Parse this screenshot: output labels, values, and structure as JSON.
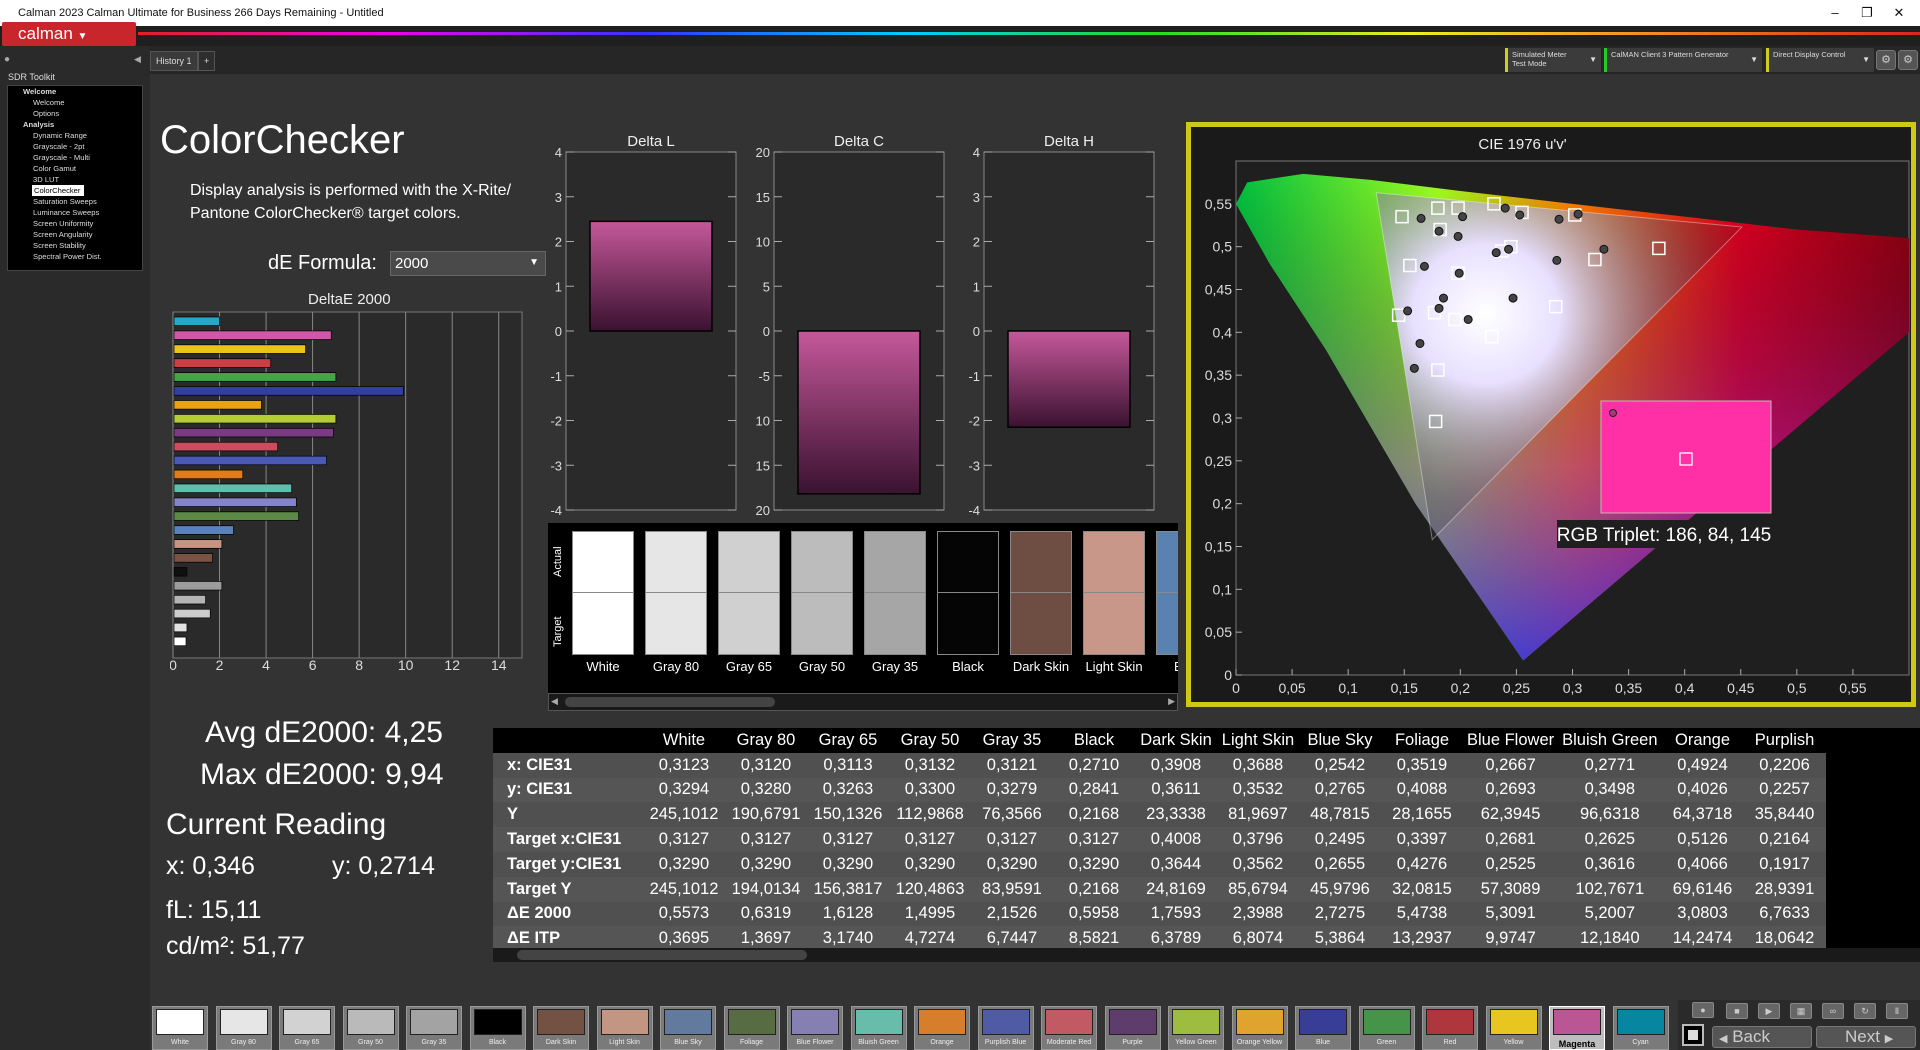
{
  "window": {
    "title": "Calman 2023 Calman Ultimate for Business 266 Days Remaining  - Untitled",
    "controls": [
      "–",
      "❐",
      "✕"
    ]
  },
  "app": {
    "logo": "calman",
    "history_tab": "History 1",
    "add_tab": "+"
  },
  "sources": [
    {
      "line1": "Simulated Meter",
      "line2": "Test Mode",
      "color": "#cccc22"
    },
    {
      "line1": "CalMAN Client 3 Pattern Generator",
      "line2": "",
      "color": "#22cc22"
    },
    {
      "line1": "Direct Display Control",
      "line2": "",
      "color": "#cccc22"
    }
  ],
  "toolkit": {
    "title": "SDR Toolkit",
    "tree": [
      {
        "label": "Welcome",
        "level": 0,
        "bold": true,
        "selected": false
      },
      {
        "label": "Welcome",
        "level": 1,
        "bold": false,
        "selected": false
      },
      {
        "label": "Options",
        "level": 1,
        "bold": false,
        "selected": false
      },
      {
        "label": "Analysis",
        "level": 0,
        "bold": true,
        "selected": false
      },
      {
        "label": "Dynamic Range",
        "level": 1,
        "bold": false,
        "selected": false
      },
      {
        "label": "Grayscale - 2pt",
        "level": 1,
        "bold": false,
        "selected": false
      },
      {
        "label": "Grayscale - Multi",
        "level": 1,
        "bold": false,
        "selected": false
      },
      {
        "label": "Color Gamut",
        "level": 1,
        "bold": false,
        "selected": false
      },
      {
        "label": "3D LUT",
        "level": 1,
        "bold": false,
        "selected": false
      },
      {
        "label": "ColorChecker",
        "level": 1,
        "bold": false,
        "selected": true
      },
      {
        "label": "Saturation Sweeps",
        "level": 1,
        "bold": false,
        "selected": false
      },
      {
        "label": "Luminance Sweeps",
        "level": 1,
        "bold": false,
        "selected": false
      },
      {
        "label": "Screen Uniformity",
        "level": 1,
        "bold": false,
        "selected": false
      },
      {
        "label": "Screen Angularity",
        "level": 1,
        "bold": false,
        "selected": false
      },
      {
        "label": "Screen Stability",
        "level": 1,
        "bold": false,
        "selected": false
      },
      {
        "label": "Spectral Power Dist.",
        "level": 1,
        "bold": false,
        "selected": false
      }
    ]
  },
  "page": {
    "title": "ColorChecker",
    "desc1": "Display analysis is performed with the X-Rite/",
    "desc2": "Pantone ColorChecker® target colors.",
    "formula_label": "dE Formula:",
    "formula_value": "2000",
    "avg": "Avg dE2000: 4,25",
    "max": "Max dE2000: 9,94",
    "current_title": "Current Reading",
    "cur_x": "x: 0,346",
    "cur_y": "y: 0,2714",
    "fl": "fL: 15,11",
    "cdm": "cd/m²: 51,77",
    "rgb_triplet": "RGB Triplet: 186, 84, 145"
  },
  "chart_data": [
    {
      "type": "bar",
      "orientation": "horizontal",
      "title": "DeltaE 2000",
      "xticks": [
        "0",
        "2",
        "4",
        "6",
        "8",
        "10",
        "12",
        "14"
      ],
      "xlim": [
        0,
        15
      ],
      "values": [
        2.0,
        6.8,
        5.7,
        4.2,
        7.0,
        9.9,
        3.8,
        7.0,
        6.9,
        4.5,
        6.6,
        3.0,
        5.1,
        5.3,
        5.4,
        2.6,
        2.1,
        1.7,
        0.6,
        2.1,
        1.4,
        1.6,
        0.6,
        0.56
      ],
      "colors": [
        "#2aa6c6",
        "#d357a8",
        "#e8c21d",
        "#cc3d44",
        "#44a544",
        "#333f9e",
        "#e8a21a",
        "#b4cc36",
        "#7a3a84",
        "#cc4d60",
        "#4a5ab4",
        "#e07c1a",
        "#5cc0aa",
        "#8484c8",
        "#5c8a46",
        "#5a82b8",
        "#c89482",
        "#7a5244",
        "#101010",
        "#9c9c9c",
        "#b4b4b4",
        "#cccccc",
        "#e2e2e2",
        "#ffffff"
      ]
    },
    {
      "type": "bar",
      "title": "Delta L",
      "yticks": [
        "4",
        "3",
        "2",
        "1",
        "0",
        "-1",
        "-2",
        "-3",
        "-4"
      ],
      "ylim": [
        -4,
        4
      ],
      "value": 2.45
    },
    {
      "type": "bar",
      "title": "Delta C",
      "yticks": [
        "20",
        "15",
        "10",
        "5",
        "0",
        "-5",
        "-10",
        "-15",
        "-20"
      ],
      "ylim": [
        -20,
        20
      ],
      "value": -18.2
    },
    {
      "type": "bar",
      "title": "Delta H",
      "yticks": [
        "4",
        "3",
        "2",
        "1",
        "0",
        "-1",
        "-2",
        "-3",
        "-4"
      ],
      "ylim": [
        -4,
        4
      ],
      "value": -2.15
    },
    {
      "type": "scatter",
      "title": "CIE 1976 u'v'",
      "xticks": [
        "0",
        "0,05",
        "0,1",
        "0,15",
        "0,2",
        "0,25",
        "0,3",
        "0,35",
        "0,4",
        "0,45",
        "0,5",
        "0,55"
      ],
      "yticks": [
        "0,55",
        "0,5",
        "0,45",
        "0,4",
        "0,35",
        "0,3",
        "0,25",
        "0,2",
        "0,15",
        "0,1",
        "0,05",
        "0"
      ],
      "xlim": [
        0,
        0.6
      ],
      "ylim": [
        0,
        0.6
      ],
      "targets": [
        [
          0.148,
          0.535
        ],
        [
          0.18,
          0.545
        ],
        [
          0.198,
          0.545
        ],
        [
          0.23,
          0.55
        ],
        [
          0.255,
          0.54
        ],
        [
          0.302,
          0.537
        ],
        [
          0.182,
          0.52
        ],
        [
          0.245,
          0.5
        ],
        [
          0.237,
          0.495
        ],
        [
          0.377,
          0.498
        ],
        [
          0.32,
          0.485
        ],
        [
          0.155,
          0.478
        ],
        [
          0.198,
          0.469
        ],
        [
          0.145,
          0.42
        ],
        [
          0.177,
          0.423
        ],
        [
          0.195,
          0.415
        ],
        [
          0.285,
          0.43
        ],
        [
          0.228,
          0.395
        ],
        [
          0.18,
          0.356
        ],
        [
          0.178,
          0.296
        ]
      ],
      "measured": [
        [
          0.165,
          0.533
        ],
        [
          0.181,
          0.518
        ],
        [
          0.202,
          0.535
        ],
        [
          0.24,
          0.545
        ],
        [
          0.253,
          0.537
        ],
        [
          0.288,
          0.532
        ],
        [
          0.305,
          0.538
        ],
        [
          0.198,
          0.512
        ],
        [
          0.232,
          0.493
        ],
        [
          0.243,
          0.497
        ],
        [
          0.286,
          0.484
        ],
        [
          0.328,
          0.497
        ],
        [
          0.168,
          0.477
        ],
        [
          0.199,
          0.469
        ],
        [
          0.185,
          0.44
        ],
        [
          0.181,
          0.428
        ],
        [
          0.247,
          0.44
        ],
        [
          0.153,
          0.425
        ],
        [
          0.207,
          0.415
        ],
        [
          0.164,
          0.387
        ],
        [
          0.159,
          0.358
        ]
      ]
    }
  ],
  "swatch_panel": {
    "row_actual": "Actual",
    "row_target": "Target",
    "swatches": [
      {
        "label": "White",
        "color": "#ffffff"
      },
      {
        "label": "Gray 80",
        "color": "#e6e6e6"
      },
      {
        "label": "Gray 65",
        "color": "#d0d0d0"
      },
      {
        "label": "Gray 50",
        "color": "#bcbcbc"
      },
      {
        "label": "Gray 35",
        "color": "#a6a6a6"
      },
      {
        "label": "Black",
        "color": "#050505"
      },
      {
        "label": "Dark Skin",
        "color": "#6e4e42"
      },
      {
        "label": "Light Skin",
        "color": "#c8978a"
      },
      {
        "label": "Blue",
        "color": "#5a82b0"
      }
    ]
  },
  "table": {
    "columns": [
      "White",
      "Gray 80",
      "Gray 65",
      "Gray 50",
      "Gray 35",
      "Black",
      "Dark Skin",
      "Light Skin",
      "Blue Sky",
      "Foliage",
      "Blue Flower",
      "Bluish Green",
      "Orange",
      "Purplish"
    ],
    "rows": [
      {
        "label": "x: CIE31",
        "values": [
          "0,3123",
          "0,3120",
          "0,3113",
          "0,3132",
          "0,3121",
          "0,2710",
          "0,3908",
          "0,3688",
          "0,2542",
          "0,3519",
          "0,2667",
          "0,2771",
          "0,4924",
          "0,2206"
        ]
      },
      {
        "label": "y: CIE31",
        "values": [
          "0,3294",
          "0,3280",
          "0,3263",
          "0,3300",
          "0,3279",
          "0,2841",
          "0,3611",
          "0,3532",
          "0,2765",
          "0,4088",
          "0,2693",
          "0,3498",
          "0,4026",
          "0,2257"
        ]
      },
      {
        "label": "Y",
        "values": [
          "245,1012",
          "190,6791",
          "150,1326",
          "112,9868",
          "76,3566",
          "0,2168",
          "23,3338",
          "81,9697",
          "48,7815",
          "28,1655",
          "62,3945",
          "96,6318",
          "64,3718",
          "35,8440"
        ]
      },
      {
        "label": "Target x:CIE31",
        "values": [
          "0,3127",
          "0,3127",
          "0,3127",
          "0,3127",
          "0,3127",
          "0,3127",
          "0,4008",
          "0,3796",
          "0,2495",
          "0,3397",
          "0,2681",
          "0,2625",
          "0,5126",
          "0,2164"
        ]
      },
      {
        "label": "Target y:CIE31",
        "values": [
          "0,3290",
          "0,3290",
          "0,3290",
          "0,3290",
          "0,3290",
          "0,3290",
          "0,3644",
          "0,3562",
          "0,2655",
          "0,4276",
          "0,2525",
          "0,3616",
          "0,4066",
          "0,1917"
        ]
      },
      {
        "label": "Target Y",
        "values": [
          "245,1012",
          "194,0134",
          "156,3817",
          "120,4863",
          "83,9591",
          "0,2168",
          "24,8169",
          "85,6794",
          "45,9796",
          "32,0815",
          "57,3089",
          "102,7671",
          "69,6146",
          "28,9391"
        ]
      },
      {
        "label": "ΔE 2000",
        "values": [
          "0,5573",
          "0,6319",
          "1,6128",
          "1,4995",
          "2,1526",
          "0,5958",
          "1,7593",
          "2,3988",
          "2,7275",
          "5,4738",
          "5,3091",
          "5,2007",
          "3,0803",
          "6,7633"
        ]
      },
      {
        "label": "ΔE ITP",
        "values": [
          "0,3695",
          "1,3697",
          "3,1740",
          "4,7274",
          "6,7447",
          "8,5821",
          "6,3789",
          "6,8074",
          "5,3864",
          "13,2937",
          "9,9747",
          "12,1840",
          "14,2474",
          "18,0642"
        ]
      }
    ]
  },
  "patches": [
    {
      "label": "White",
      "color": "#ffffff"
    },
    {
      "label": "Gray 80",
      "color": "#e6e6e6"
    },
    {
      "label": "Gray 65",
      "color": "#d2d2d2"
    },
    {
      "label": "Gray 50",
      "color": "#bababa"
    },
    {
      "label": "Gray 35",
      "color": "#a3a3a3"
    },
    {
      "label": "Black",
      "color": "#000000"
    },
    {
      "label": "Dark Skin",
      "color": "#735244"
    },
    {
      "label": "Light Skin",
      "color": "#c29682"
    },
    {
      "label": "Blue Sky",
      "color": "#627a9d"
    },
    {
      "label": "Foliage",
      "color": "#576c43"
    },
    {
      "label": "Blue Flower",
      "color": "#8580b1"
    },
    {
      "label": "Bluish Green",
      "color": "#67bdaa"
    },
    {
      "label": "Orange",
      "color": "#d67e2c"
    },
    {
      "label": "Purplish Blue",
      "color": "#505ba6"
    },
    {
      "label": "Moderate Red",
      "color": "#c15a63"
    },
    {
      "label": "Purple",
      "color": "#5e3c6c"
    },
    {
      "label": "Yellow Green",
      "color": "#9dbc40"
    },
    {
      "label": "Orange Yellow",
      "color": "#e0a32e"
    },
    {
      "label": "Blue",
      "color": "#383d96"
    },
    {
      "label": "Green",
      "color": "#469449"
    },
    {
      "label": "Red",
      "color": "#af363c"
    },
    {
      "label": "Yellow",
      "color": "#e7c71f"
    },
    {
      "label": "Magenta",
      "color": "#bb5695"
    },
    {
      "label": "Cyan",
      "color": "#0885a1"
    }
  ],
  "active_patch": "Magenta",
  "nav": {
    "back": "Back",
    "next": "Next"
  }
}
